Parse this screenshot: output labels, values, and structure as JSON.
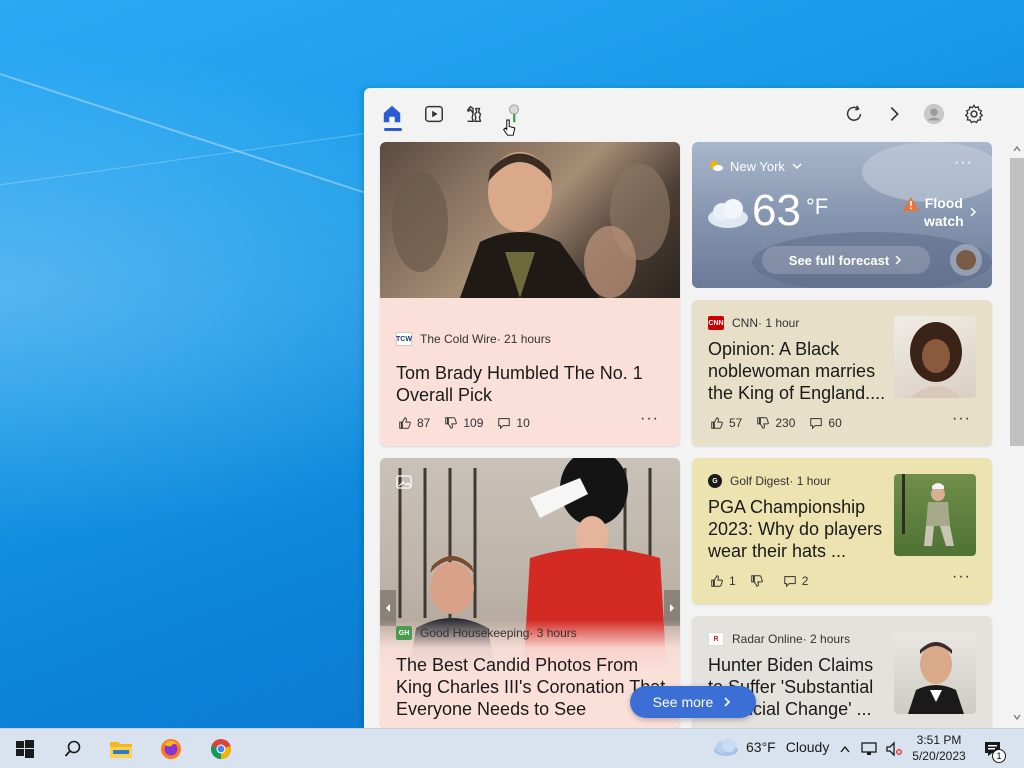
{
  "widgets": {
    "nav": {
      "icons": [
        "home-icon",
        "video-icon",
        "chess-icon",
        "golf-icon"
      ],
      "right_icons": [
        "refresh-icon",
        "chevron-right-icon",
        "profile-icon",
        "gear-icon"
      ]
    },
    "weather": {
      "location": "New York",
      "temp": "63",
      "unit": "°F",
      "alert_line1": "Flood",
      "alert_line2": "watch",
      "forecast_link": "See full forecast"
    },
    "cards": [
      {
        "source": "The Cold Wire",
        "source_logo": "TCW",
        "age": " · 21 hours",
        "headline": "Tom Brady Humbled The No. 1 Overall Pick",
        "likes": "87",
        "dislikes": "109",
        "comments": "10"
      },
      {
        "source": "CNN",
        "source_logo": "CNN",
        "age": " · 1 hour",
        "headline": "Opinion: A Black noblewoman marries the King of England....",
        "likes": "57",
        "dislikes": "230",
        "comments": "60"
      },
      {
        "source": "Golf Digest",
        "source_logo": "G",
        "age": " · 1 hour",
        "headline": "PGA Championship 2023: Why do players wear their hats ...",
        "likes": "1",
        "dislikes": "",
        "comments": "2"
      },
      {
        "source": "Good Housekeeping",
        "source_logo": "GH",
        "age": " · 3 hours",
        "headline": "The Best Candid Photos From King Charles III's Coronation That Everyone Needs to See"
      },
      {
        "source": "Radar Online",
        "source_logo": "R",
        "age": " · 2 hours",
        "headline": "Hunter Biden Claims to Suffer 'Substantial Financial Change' ..."
      }
    ],
    "see_more": "See more",
    "colors": {
      "accent": "#3b6fd6",
      "active_tab": "#2b5cd6"
    }
  },
  "taskbar": {
    "weather_temp": "63°F",
    "weather_desc": "Cloudy",
    "time": "3:51 PM",
    "date": "5/20/2023",
    "notification_count": "1",
    "pinned": [
      "windows-start-icon",
      "search-icon",
      "file-explorer-icon",
      "firefox-icon",
      "chrome-icon"
    ]
  }
}
